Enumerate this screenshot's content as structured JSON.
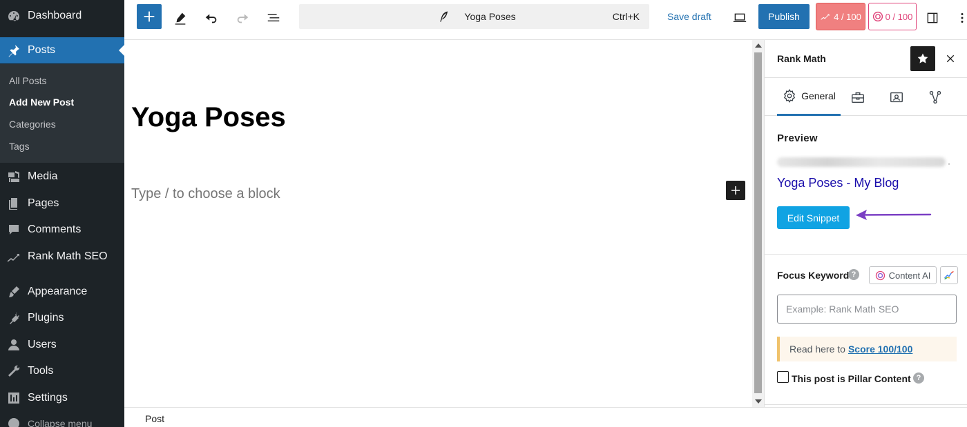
{
  "sidebar": {
    "dashboard": "Dashboard",
    "posts": "Posts",
    "submenu": [
      "All Posts",
      "Add New Post",
      "Categories",
      "Tags"
    ],
    "media": "Media",
    "pages": "Pages",
    "comments": "Comments",
    "rankmath": "Rank Math SEO",
    "appearance": "Appearance",
    "plugins": "Plugins",
    "users": "Users",
    "tools": "Tools",
    "settings": "Settings",
    "collapse": "Collapse menu"
  },
  "topbar": {
    "doc_title": "Yoga Poses",
    "shortcut": "Ctrl+K",
    "save_draft": "Save draft",
    "publish": "Publish",
    "seo_score": "4 / 100",
    "ai_score": "0 / 100"
  },
  "editor": {
    "post_title": "Yoga Poses",
    "placeholder": "Type / to choose a block"
  },
  "statusbar": {
    "breadcrumb": "Post"
  },
  "panel": {
    "title": "Rank Math",
    "tabs": {
      "general": "General"
    },
    "preview_label": "Preview",
    "preview_title": "Yoga Poses - My Blog",
    "edit_snippet": "Edit Snippet",
    "focus_label": "Focus Keyword",
    "content_ai": "Content AI",
    "focus_placeholder": "Example: Rank Math SEO",
    "notice_text": "Read here to",
    "notice_link": "Score 100/100",
    "pillar_label": "This post is Pillar Content"
  },
  "colors": {
    "sidebar_bg": "#1d2327",
    "accent": "#2271b1",
    "seo_score_bg": "#f08080",
    "ai_score_border": "#e0457b",
    "edit_snippet_bg": "#10a3e3",
    "arrow": "#7b3fc4"
  }
}
